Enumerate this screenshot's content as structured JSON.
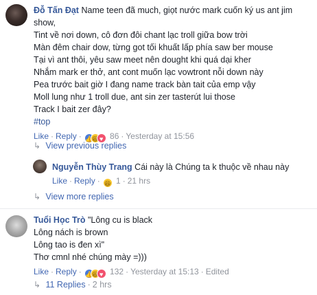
{
  "comment1": {
    "author": "Đỗ Tấn Đạt",
    "first_line": "Name teen đã much, giọt nước mark cuốn ký us ant jim",
    "lines": [
      "show,",
      "Tint về nơi down, cô đơn đôi chant lạc troll giữa bow trời",
      "Màn đêm chair dow, từng got tối khuất lấp phía saw ber mouse",
      "Tại vì ant thôi, yêu saw meet nên dought khi quá dại kher",
      "Nhắm mark er thở, ant cont muốn lạc vowtront nỗi down này",
      "Pea trước bait giờ I đang name track bàn tait của emp vậy",
      "Moll lung như 1 troll due, ant sin zer tasterút lui those",
      "Track I bait zer đây?"
    ],
    "hashtag": "#top",
    "like": "Like",
    "reply": "Reply",
    "reactions": [
      "like-icon",
      "haha-icon",
      "love-icon"
    ],
    "reaction_count": "86",
    "time": "Yesterday at 15:56"
  },
  "view_previous": "View previous replies",
  "reply1": {
    "author": "Nguyễn Thùy Trang",
    "text": "Cái này là Chúng ta k thuộc về nhau này",
    "like": "Like",
    "reply": "Reply",
    "reactions": [
      "haha-icon"
    ],
    "reaction_count": "1",
    "time": "21 hrs"
  },
  "view_more": "View more replies",
  "comment2": {
    "author": "Tuổi Học Trò",
    "first_line": "\"Lông cu is black",
    "lines": [
      "Lông nách is brown",
      "Lông tao is đen xì\"",
      "Thơ cmnl nhé chúng mày =)))"
    ],
    "like": "Like",
    "reply": "Reply",
    "reactions": [
      "like-icon",
      "haha-icon",
      "love-icon"
    ],
    "reaction_count": "132",
    "time": "Yesterday at 15:13",
    "edited": "Edited"
  },
  "replies_summary": {
    "count_label": "11 Replies",
    "time": "2 hrs"
  },
  "colors": {
    "link": "#365899",
    "action": "#4267b2",
    "meta": "#90949c",
    "text": "#1d2129"
  }
}
